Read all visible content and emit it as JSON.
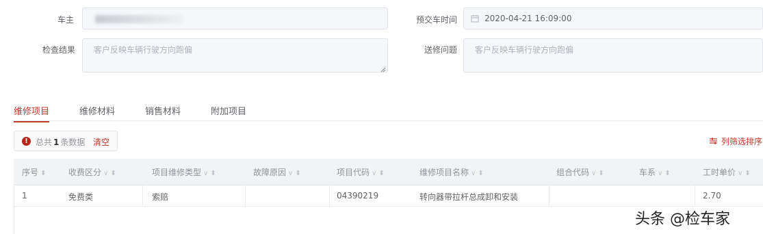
{
  "form": {
    "owner_label": "车主",
    "owner_value": "",
    "pickup_time_label": "预交车时间",
    "pickup_time_value": "2020-04-21 16:09:00",
    "inspection_label": "检查结果",
    "inspection_value": "客户反映车辆行驶方向跑偏",
    "repair_issue_label": "送修问题",
    "repair_issue_value": "客户反映车辆行驶方向跑偏"
  },
  "tabs": [
    {
      "label": "维修项目",
      "active": true
    },
    {
      "label": "维修材料",
      "active": false
    },
    {
      "label": "销售材料",
      "active": false
    },
    {
      "label": "附加项目",
      "active": false
    }
  ],
  "summary": {
    "prefix": "总共",
    "count": "1",
    "suffix": "条数据",
    "clear_label": "清空"
  },
  "column_filter_label": "列筛选排序",
  "table": {
    "headers": [
      "序号",
      "收费区分",
      "项目维修类型",
      "故障原因",
      "项目代码",
      "维修项目名称",
      "组合代码",
      "车系",
      "工时单价"
    ],
    "rows": [
      [
        "1",
        "免费类",
        "索赔",
        "",
        "04390219",
        "转向器带拉杆总成卸和安装",
        "",
        "",
        "2.70"
      ]
    ]
  },
  "watermark": "头条 @检车家",
  "colors": {
    "accent": "#c0392b",
    "field_bg": "#f5f7fa",
    "header_bg": "#f2f3f5"
  },
  "icons": [
    "calendar-icon",
    "info-icon",
    "filter-icon",
    "sort-icon",
    "chevron-down-icon",
    "resize-handle-icon"
  ]
}
